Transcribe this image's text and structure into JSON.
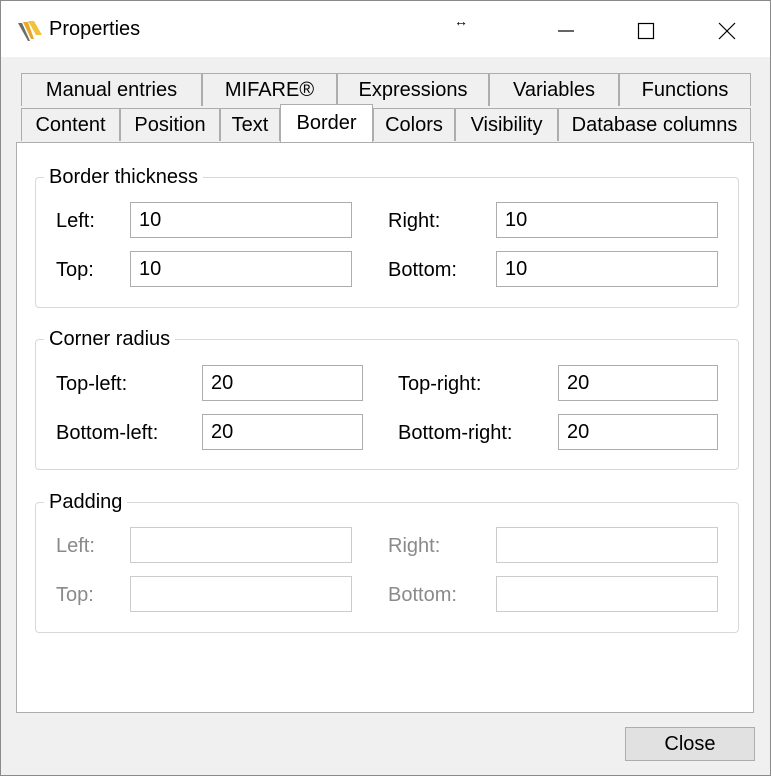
{
  "window": {
    "title": "Properties",
    "resize_glyph": "↔",
    "icons": [
      "app-icon",
      "minimize-icon",
      "maximize-icon",
      "close-icon"
    ]
  },
  "tabs": {
    "row1": [
      "Manual entries",
      "MIFARE®",
      "Expressions",
      "Variables",
      "Functions"
    ],
    "row2": [
      "Content",
      "Position",
      "Text",
      "Border",
      "Colors",
      "Visibility",
      "Database columns"
    ],
    "active": "Border"
  },
  "border_thickness": {
    "title": "Border thickness",
    "left_label": "Left:",
    "left_value": "10",
    "right_label": "Right:",
    "right_value": "10",
    "top_label": "Top:",
    "top_value": "10",
    "bottom_label": "Bottom:",
    "bottom_value": "10"
  },
  "corner_radius": {
    "title": "Corner radius",
    "top_left_label": "Top-left:",
    "top_left_value": "20",
    "top_right_label": "Top-right:",
    "top_right_value": "20",
    "bottom_left_label": "Bottom-left:",
    "bottom_left_value": "20",
    "bottom_right_label": "Bottom-right:",
    "bottom_right_value": "20"
  },
  "padding": {
    "title": "Padding",
    "left_label": "Left:",
    "left_value": "",
    "right_label": "Right:",
    "right_value": "",
    "top_label": "Top:",
    "top_value": "",
    "bottom_label": "Bottom:",
    "bottom_value": ""
  },
  "buttons": {
    "close": "Close"
  }
}
